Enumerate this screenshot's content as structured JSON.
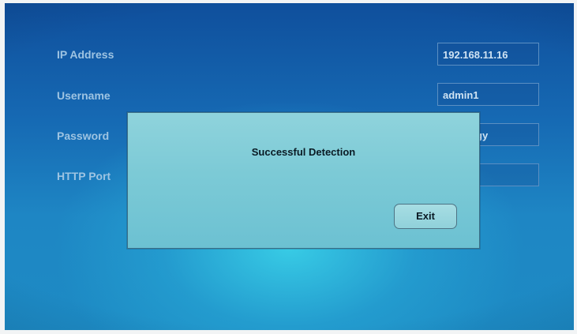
{
  "form": {
    "ip_label": "IP Address",
    "ip_value": "192.168.11.16",
    "username_label": "Username",
    "username_value": "admin1",
    "password_label": "Password",
    "password_value_visible": "gy",
    "http_port_label": "HTTP Port",
    "http_port_value": ""
  },
  "dialog": {
    "message": "Successful Detection",
    "exit_label": "Exit"
  }
}
